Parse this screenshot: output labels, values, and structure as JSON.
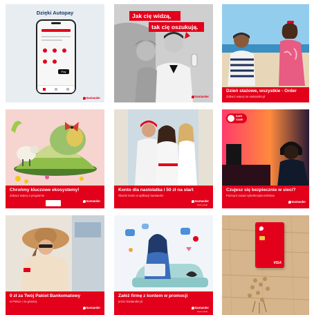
{
  "brand": "Santander",
  "brand_sub": "bank polski",
  "accent_color": "#e3001b",
  "tiles": [
    {
      "id": "autopay",
      "title": "Dzięki Autopay",
      "phone_btn": "Pay"
    },
    {
      "id": "scam",
      "headline_1": "Jak cię widzą,",
      "headline_2": "tak cię oszukują."
    },
    {
      "id": "order",
      "caption": "Dzień stażowe, wszystkie - Order",
      "sub": "Zobacz więcej na santander.pl"
    },
    {
      "id": "eco",
      "caption": "Chrońmy kluczowe ekosystemy!",
      "sub": "Zobacz więcej o programie"
    },
    {
      "id": "teens",
      "caption": "Konto dla nastolatka i 50 zł na start",
      "sub": "Otwórz konto w aplikacji Santander"
    },
    {
      "id": "gaming",
      "caption": "Czujesz się bezpiecznie w sieci?",
      "sub": "Poznaj 5 zasad cyberbezpieczeństwa",
      "badge": "SAFE GAME"
    },
    {
      "id": "hat",
      "caption": "0 zł za Twój Pakiet Bankomatowy",
      "sub": "w Polsce i za granicą"
    },
    {
      "id": "business",
      "caption": "Załóż firmę z kontem w promocji",
      "sub": "przez Santander.pl"
    },
    {
      "id": "card",
      "card_brand": "VISA"
    }
  ]
}
